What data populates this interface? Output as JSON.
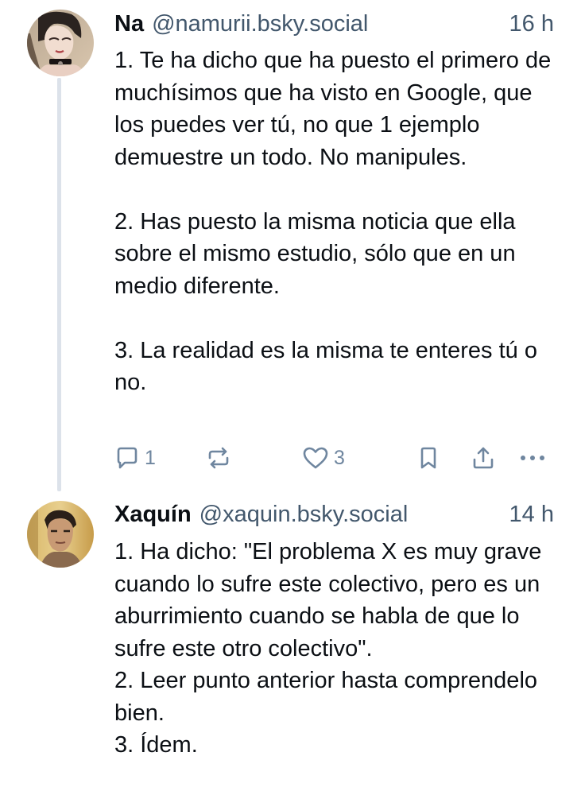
{
  "posts": [
    {
      "display_name": "Na",
      "handle": "@namurii.bsky.social",
      "time": "16 h",
      "avatar_icon": "illustrated-avatar",
      "paragraphs": [
        "1. Te ha dicho que ha puesto el primero de muchísimos que ha visto en Google, que los puedes ver tú, no que 1 ejemplo demuestre un todo. No manipules.",
        "",
        "2. Has puesto la misma noticia que ella sobre el mismo estudio, sólo que en un medio diferente.",
        "",
        "3. La realidad es la misma te enteres tú o no."
      ],
      "actions": {
        "reply_count": "1",
        "like_count": "3"
      }
    },
    {
      "display_name": "Xaquín",
      "handle": "@xaquin.bsky.social",
      "time": "14 h",
      "avatar_icon": "photo-avatar",
      "paragraphs": [
        "1. Ha dicho: \"El problema X es muy grave cuando lo sufre este colectivo, pero es un aburrimiento cuando se habla de que lo sufre este otro colectivo\".",
        "2. Leer punto anterior hasta comprendelo bien.",
        "3. Ídem."
      ]
    }
  ],
  "icons": {
    "reply": "speech-bubble-icon",
    "repost": "repost-arrows-icon",
    "like": "heart-icon",
    "bookmark": "bookmark-icon",
    "share": "share-upload-icon",
    "more": "ellipsis-icon"
  },
  "colors": {
    "text": "#0b0f14",
    "secondary": "#42576c",
    "icon": "#6f869f",
    "thread_line": "#dce2ea"
  }
}
